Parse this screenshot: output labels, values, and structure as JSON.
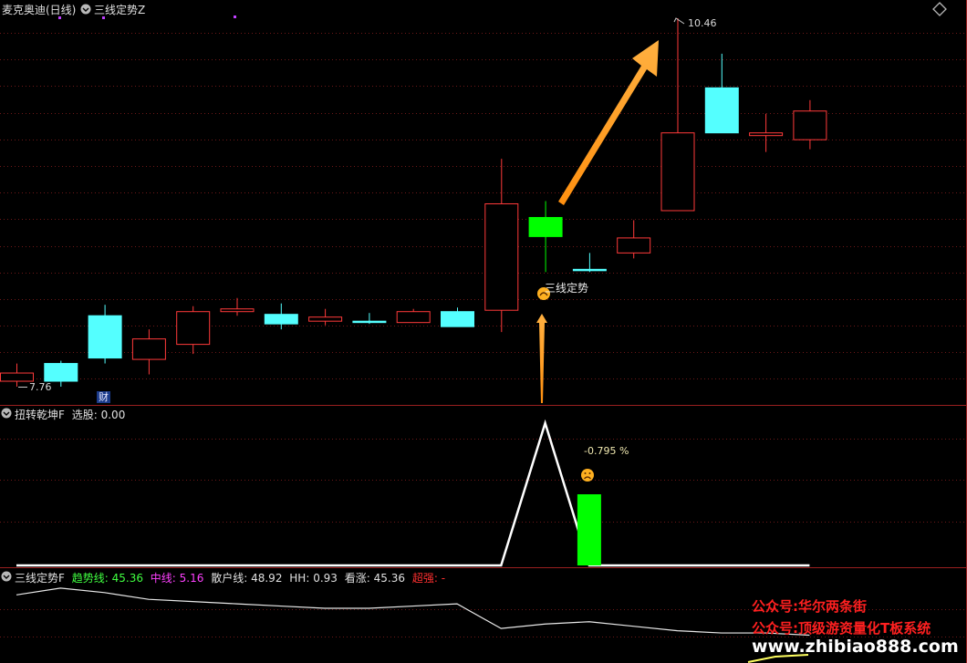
{
  "main_panel": {
    "title": "麦克奥迪(日线)",
    "indicator": "三线定势Z",
    "high_label": "10.46",
    "low_label": "7.76",
    "cai_badge": "财",
    "signal_label": "三线定势"
  },
  "middle_panel": {
    "indicator": "扭转乾坤F",
    "pick_label": "选股:",
    "pick_value": "0.00",
    "percent_label": "-0.795 %"
  },
  "bottom_panel": {
    "indicator": "三线定势F",
    "trend_label": "趋势线:",
    "trend_value": "45.36",
    "mid_label": "中线:",
    "mid_value": "5.16",
    "retail_label": "散户线:",
    "retail_value": "48.92",
    "hh_label": "HH:",
    "hh_value": "0.93",
    "bull_label": "看涨:",
    "bull_value": "45.36",
    "strong_label": "超强:",
    "strong_value": "-"
  },
  "watermark": {
    "line1": "公众号:华尔两条街",
    "line2": "公众号:顶级游资量化T板系统",
    "line3": "www.zhibiao888.com"
  },
  "colors": {
    "up": "#ff3a3a",
    "down": "#54ffff",
    "signal": "#00ff00",
    "arrow": "#ffa020",
    "grid": "#7a1a1a",
    "watermark": "#ff2020"
  },
  "chart_data": [
    {
      "type": "candlestick",
      "candles": [
        {
          "open": 7.8,
          "close": 7.86,
          "high": 7.93,
          "low": 7.76,
          "dir": "up"
        },
        {
          "open": 7.93,
          "close": 7.8,
          "high": 7.95,
          "low": 7.76,
          "dir": "down"
        },
        {
          "open": 8.28,
          "close": 7.97,
          "high": 8.36,
          "low": 7.93,
          "dir": "down"
        },
        {
          "open": 7.96,
          "close": 8.11,
          "high": 8.18,
          "low": 7.85,
          "dir": "up"
        },
        {
          "open": 8.07,
          "close": 8.31,
          "high": 8.35,
          "low": 8.0,
          "dir": "up"
        },
        {
          "open": 8.31,
          "close": 8.33,
          "high": 8.41,
          "low": 8.28,
          "dir": "up"
        },
        {
          "open": 8.29,
          "close": 8.22,
          "high": 8.37,
          "low": 8.18,
          "dir": "down"
        },
        {
          "open": 8.24,
          "close": 8.27,
          "high": 8.33,
          "low": 8.21,
          "dir": "up"
        },
        {
          "open": 8.24,
          "close": 8.24,
          "high": 8.3,
          "low": 8.22,
          "dir": "down"
        },
        {
          "open": 8.23,
          "close": 8.31,
          "high": 8.33,
          "low": 8.23,
          "dir": "up"
        },
        {
          "open": 8.31,
          "close": 8.2,
          "high": 8.34,
          "low": 8.2,
          "dir": "down"
        },
        {
          "open": 8.32,
          "close": 9.1,
          "high": 9.43,
          "low": 8.16,
          "dir": "up"
        },
        {
          "open": 9.0,
          "close": 8.86,
          "high": 9.12,
          "low": 8.6,
          "dir": "signal"
        },
        {
          "open": 8.62,
          "close": 8.62,
          "high": 8.74,
          "low": 8.6,
          "dir": "down"
        },
        {
          "open": 8.74,
          "close": 8.85,
          "high": 8.98,
          "low": 8.7,
          "dir": "up"
        },
        {
          "open": 9.05,
          "close": 9.62,
          "high": 10.46,
          "low": 9.05,
          "dir": "up"
        },
        {
          "open": 9.95,
          "close": 9.62,
          "high": 10.2,
          "low": 9.62,
          "dir": "down"
        },
        {
          "open": 9.62,
          "close": 9.6,
          "high": 9.76,
          "low": 9.48,
          "dir": "up"
        },
        {
          "open": 9.57,
          "close": 9.78,
          "high": 9.86,
          "low": 9.5,
          "dir": "up"
        }
      ]
    },
    {
      "type": "line",
      "series": [
        {
          "values": [
            0,
            0,
            0,
            0,
            0,
            0,
            0,
            0,
            0,
            0,
            0,
            0,
            1,
            0,
            0,
            0,
            0,
            0,
            0
          ]
        }
      ],
      "bars": [
        {
          "index": 13,
          "value": 0.5
        }
      ]
    },
    {
      "type": "line",
      "series": [
        {
          "values": [
            60,
            63,
            61,
            58,
            57,
            56,
            55,
            54,
            54,
            55,
            56,
            45,
            47,
            48,
            46,
            44,
            43,
            43,
            42
          ]
        }
      ]
    }
  ]
}
